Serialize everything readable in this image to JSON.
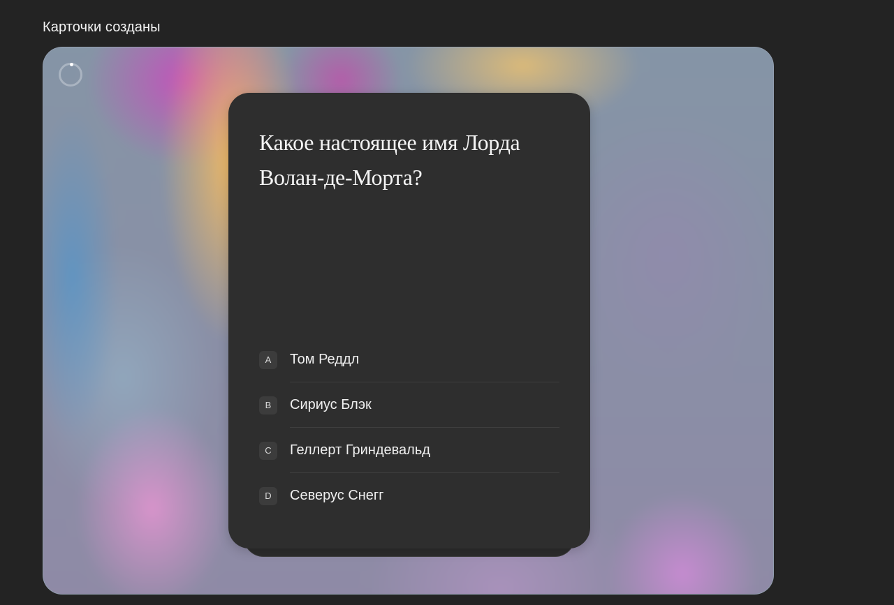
{
  "header": {
    "title": "Карточки созданы"
  },
  "card": {
    "question": "Какое настоящее имя Лорда Волан-де-Морта?",
    "answers": [
      {
        "letter": "A",
        "text": "Том Реддл"
      },
      {
        "letter": "B",
        "text": "Сириус Блэк"
      },
      {
        "letter": "C",
        "text": "Геллерт Гриндевальд"
      },
      {
        "letter": "D",
        "text": "Северус Снегг"
      }
    ]
  },
  "colors": {
    "page_background": "#232323",
    "card_background": "#2e2e2e",
    "text_primary": "#f4f4f4"
  },
  "icons": {
    "spinner": "loading-spinner-icon"
  }
}
